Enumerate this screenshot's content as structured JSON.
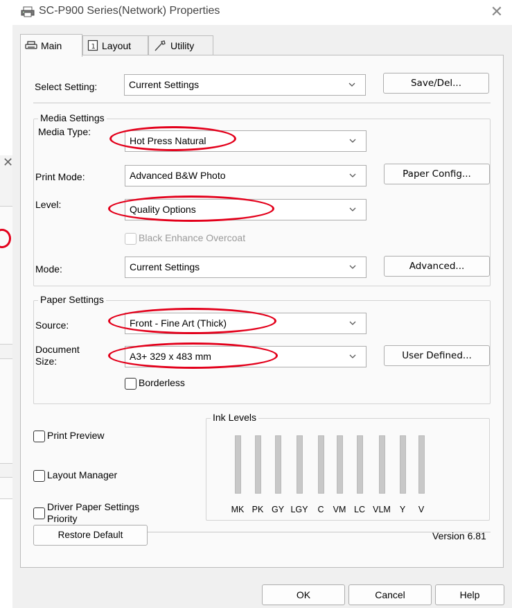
{
  "window": {
    "title": "SC-P900 Series(Network) Properties",
    "close_glyph": "✕"
  },
  "background_window": {
    "close_glyph": "✕"
  },
  "tabs": [
    {
      "label": "Main",
      "icon": "printer-icon",
      "active": true
    },
    {
      "label": "Layout",
      "icon": "layout-page-icon",
      "active": false
    },
    {
      "label": "Utility",
      "icon": "wrench-icon",
      "active": false
    }
  ],
  "select_setting": {
    "label": "Select Setting:",
    "value": "Current Settings",
    "button": "Save/Del..."
  },
  "media_settings": {
    "title": "Media Settings",
    "media_type": {
      "label": "Media Type:",
      "value": "Hot Press Natural"
    },
    "print_mode": {
      "label": "Print Mode:",
      "value": "Advanced B&W Photo",
      "button": "Paper Config..."
    },
    "level": {
      "label": "Level:",
      "value": "Quality Options"
    },
    "black_enhance": {
      "label": "Black Enhance Overcoat",
      "checked": false,
      "enabled": false
    },
    "mode": {
      "label": "Mode:",
      "value": "Current Settings",
      "button": "Advanced..."
    }
  },
  "paper_settings": {
    "title": "Paper Settings",
    "source": {
      "label": "Source:",
      "value": "Front - Fine Art (Thick)"
    },
    "document_size": {
      "label_line1": "Document",
      "label_line2": "Size:",
      "value": "A3+ 329 x 483 mm",
      "button": "User Defined..."
    },
    "borderless": {
      "label": "Borderless",
      "checked": false
    }
  },
  "options": {
    "print_preview": {
      "label": "Print Preview",
      "checked": false
    },
    "layout_manager": {
      "label": "Layout Manager",
      "checked": false
    },
    "driver_paper_priority": {
      "label_line1": "Driver Paper Settings",
      "label_line2": "Priority",
      "checked": false
    }
  },
  "ink_levels": {
    "title": "Ink Levels",
    "inks": [
      "MK",
      "PK",
      "GY",
      "LGY",
      "C",
      "VM",
      "LC",
      "VLM",
      "Y",
      "V"
    ]
  },
  "restore_default": "Restore Default",
  "version": "Version 6.81",
  "footer": {
    "ok": "OK",
    "cancel": "Cancel",
    "help": "Help"
  },
  "colors": {
    "annotation": "#e3001b",
    "panel": "#fafafa",
    "window": "#f0f0f0",
    "ink_bar": "#c8c8c8"
  }
}
